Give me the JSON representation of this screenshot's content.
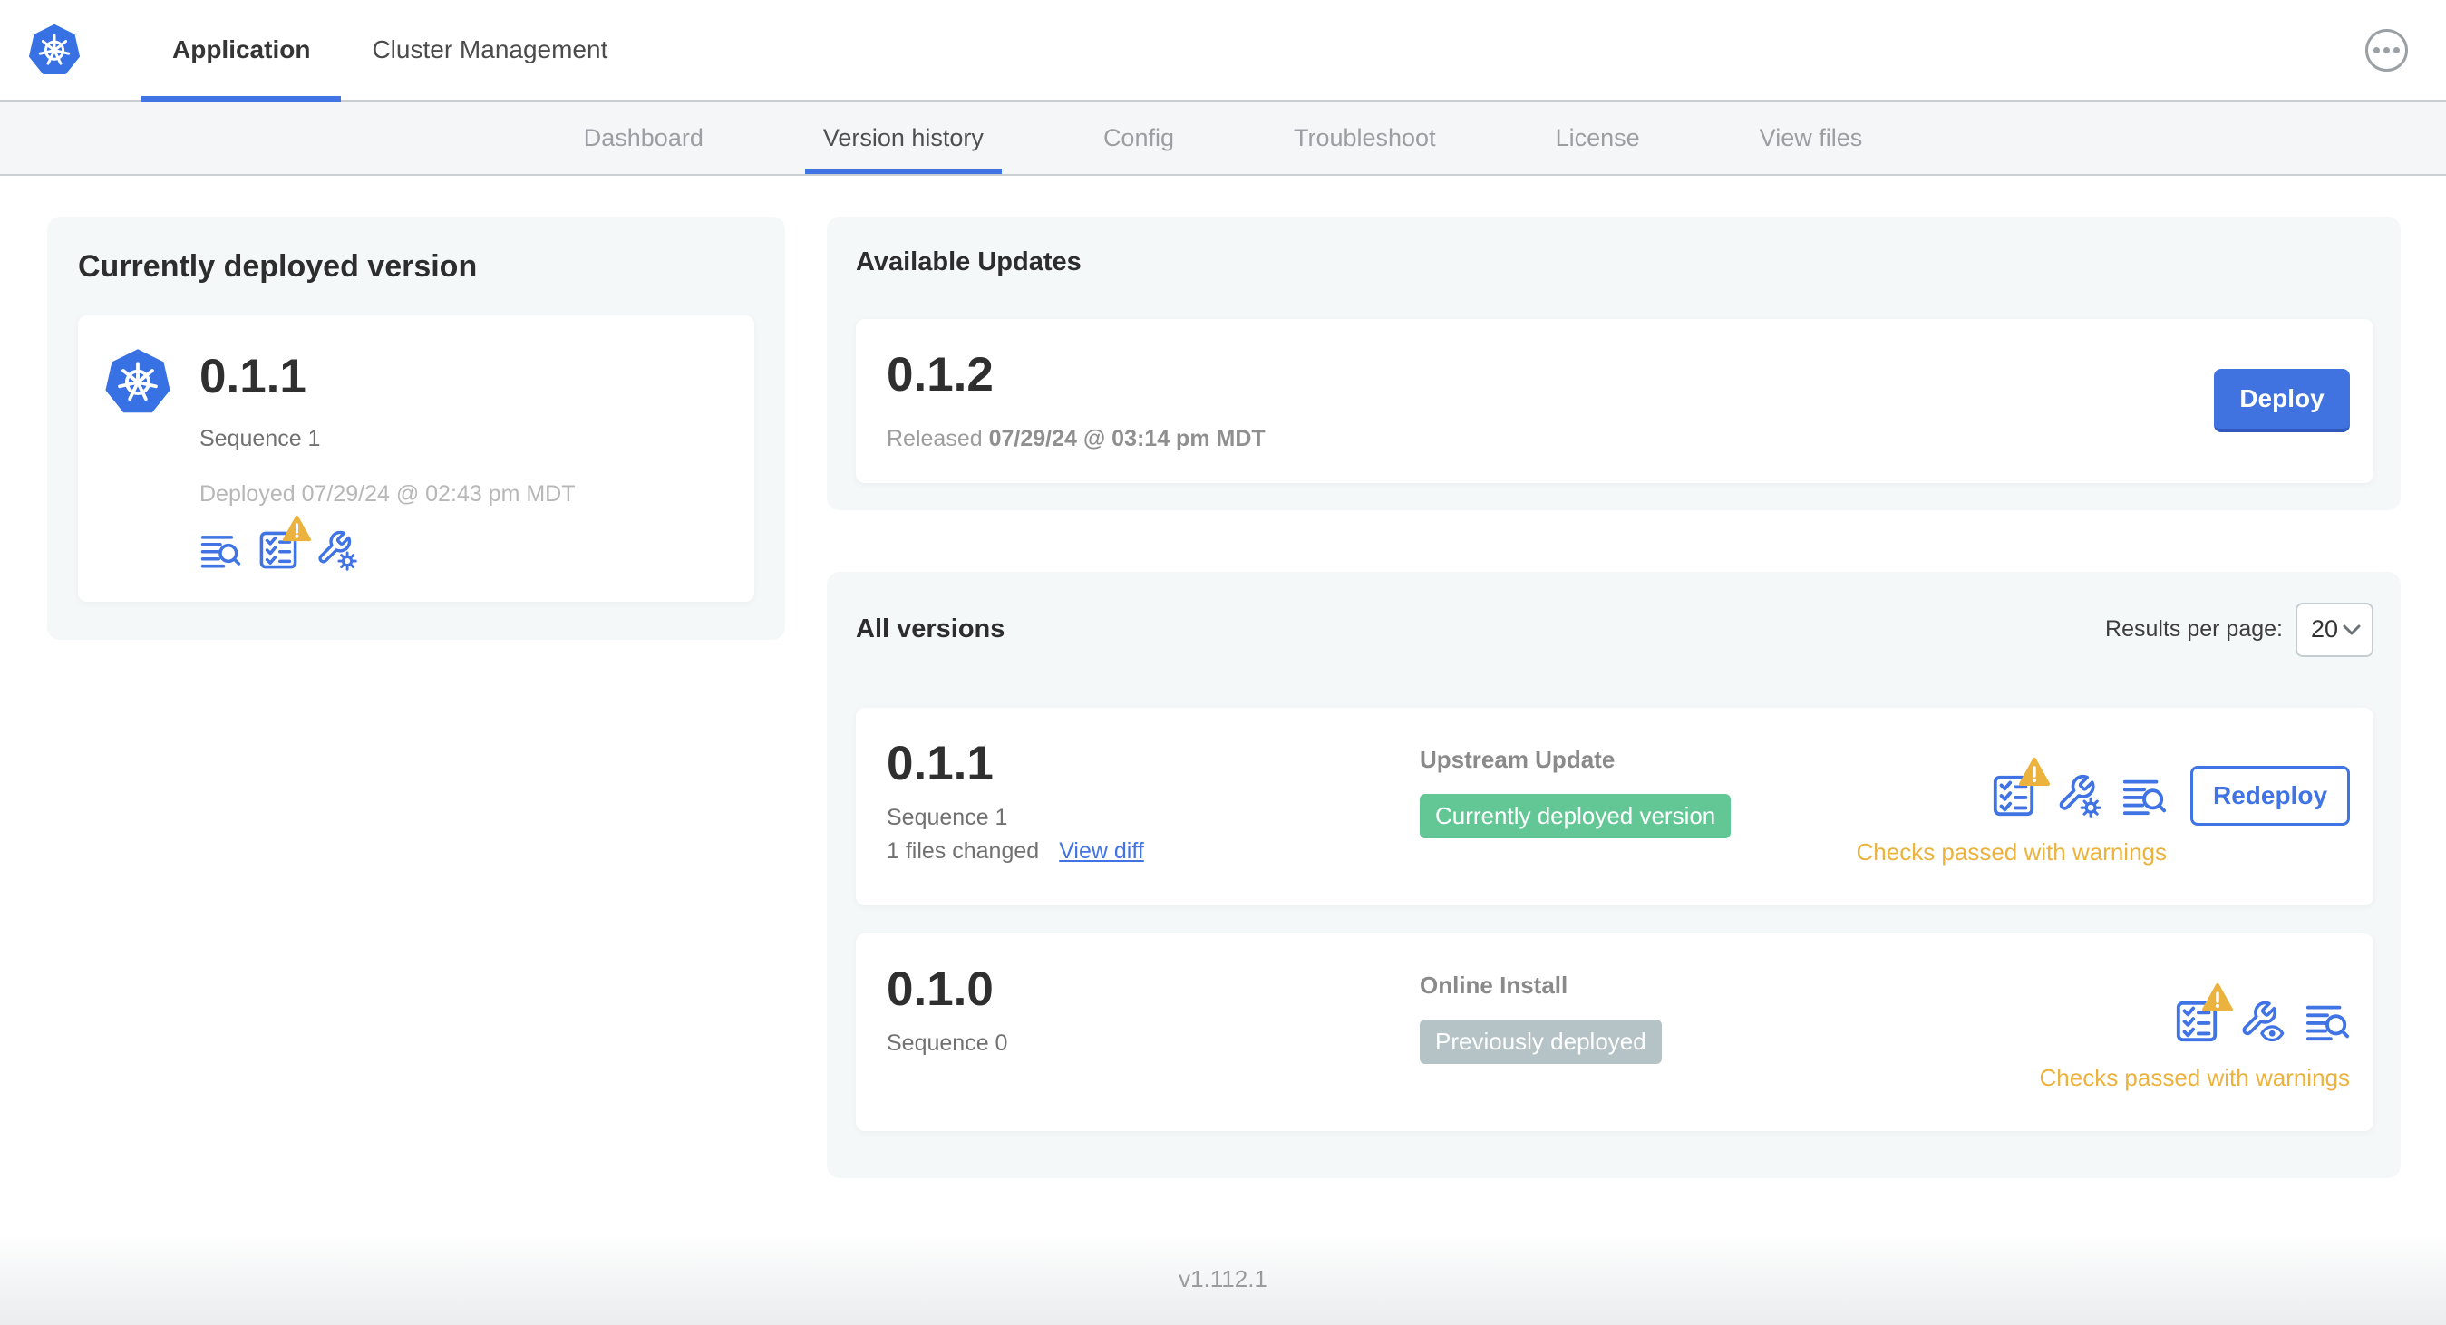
{
  "topnav": {
    "tabs": [
      {
        "label": "Application"
      },
      {
        "label": "Cluster Management"
      }
    ]
  },
  "subnav": {
    "tabs": [
      "Dashboard",
      "Version history",
      "Config",
      "Troubleshoot",
      "License",
      "View files"
    ],
    "active_tab": "Version history"
  },
  "current_version": {
    "title": "Currently deployed version",
    "version": "0.1.1",
    "sequence": "Sequence 1",
    "deployed": "Deployed 07/29/24 @ 02:43 pm MDT"
  },
  "available_updates": {
    "title": "Available Updates",
    "version": "0.1.2",
    "released_prefix": "Released ",
    "released_date": "07/29/24 @ 03:14 pm MDT",
    "deploy_label": "Deploy"
  },
  "all_versions": {
    "title": "All versions",
    "results_per_page_label": "Results per page:",
    "results_per_page_value": "20",
    "rows": [
      {
        "version": "0.1.1",
        "sequence": "Sequence 1",
        "files_changed": "1 files changed",
        "view_diff_label": "View diff",
        "source": "Upstream Update",
        "badge": "Currently deployed version",
        "badge_type": "green",
        "status": "Checks passed with warnings",
        "action_label": "Redeploy"
      },
      {
        "version": "0.1.0",
        "sequence": "Sequence 0",
        "source": "Online Install",
        "badge": "Previously deployed",
        "badge_type": "gray",
        "status": "Checks passed with warnings"
      }
    ]
  },
  "footer": {
    "app_version": "v1.112.1"
  },
  "colors": {
    "accent_blue": "#4073e3",
    "button_blue": "#4173e0",
    "badge_green": "#63c795",
    "badge_gray": "#b5c3c6",
    "warning_amber": "#ecb23e",
    "card_gray_bg": "#f5f8f9"
  }
}
